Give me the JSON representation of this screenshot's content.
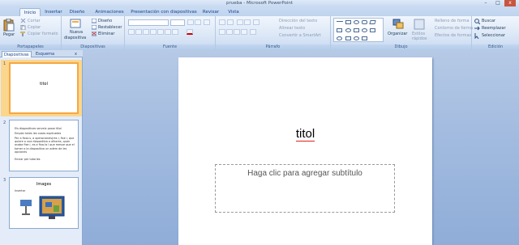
{
  "window": {
    "title": "prueba - Microsoft PowerPoint",
    "minimize": "–",
    "maximize": "□",
    "close": "x"
  },
  "tabs": [
    "Inicio",
    "Insertar",
    "Diseño",
    "Animaciones",
    "Presentación con diapositivas",
    "Revisar",
    "Vista"
  ],
  "ribbon": {
    "portapapeles": {
      "label": "Portapapeles",
      "pegar": "Pegar",
      "cortar": "Cortar",
      "copiar": "Copiar",
      "copiar_formato": "Copiar formato"
    },
    "diapositivas": {
      "label": "Diapositivas",
      "nueva": "Nueva",
      "nueva2": "diapositiva",
      "diseno": "Diseño",
      "restablecer": "Restablecer",
      "eliminar": "Eliminar"
    },
    "fuente": {
      "label": "Fuente"
    },
    "parrafo": {
      "label": "Párrafo",
      "direccion": "Dirección del texto",
      "alinear": "Alinear texto",
      "convertir": "Convertir a SmartArt"
    },
    "dibujo": {
      "label": "Dibujo",
      "organizar": "Organizar",
      "estilos": "Estilos",
      "estilos2": "rápidos",
      "relleno": "Relleno de forma",
      "contorno": "Contorno de forma",
      "efectos": "Efectos de formas"
    },
    "edicion": {
      "label": "Edición",
      "buscar": "Buscar",
      "reemplazar": "Reemplazar",
      "seleccionar": "Seleccionar"
    }
  },
  "panel": {
    "tab_diapositivas": "Diapositivas",
    "tab_esquema": "Esquema",
    "close": "x",
    "slides": [
      {
        "num": "1",
        "title": "titol"
      },
      {
        "num": "2",
        "bullets": [
          "Els diapositives serveix posar títol",
          "Emplar totes les coses explicades",
          "Per a fixar-s, a operaciones(res i, fixe i, que quiere o una diapositiva o alhores, quan acaba fixe i, es a fixa-la i que mesue que el tomer o la diapositiva un adem de les opciones",
          "Enviar per tutories"
        ]
      },
      {
        "num": "3",
        "title": "Images",
        "bullets": [
          "Insertar"
        ]
      }
    ]
  },
  "slide": {
    "title": "titol",
    "subtitle_placeholder": "Haga clic para agregar subtítulo"
  }
}
